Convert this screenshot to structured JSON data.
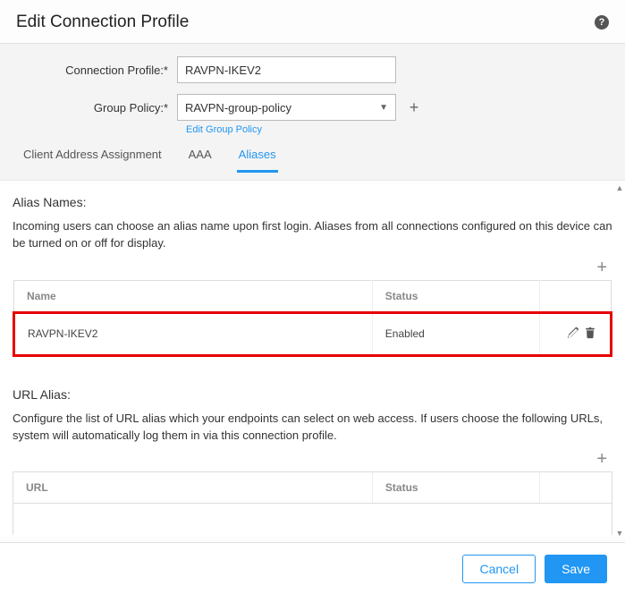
{
  "header": {
    "title": "Edit Connection Profile"
  },
  "form": {
    "connection_profile_label": "Connection Profile:*",
    "connection_profile_value": "RAVPN-IKEV2",
    "group_policy_label": "Group Policy:*",
    "group_policy_value": "RAVPN-group-policy",
    "edit_group_policy_link": "Edit Group Policy"
  },
  "tabs": {
    "client_address": "Client Address Assignment",
    "aaa": "AAA",
    "aliases": "Aliases"
  },
  "alias_names": {
    "title": "Alias Names:",
    "description": "Incoming users can choose an alias name upon first login. Aliases from all connections configured on this device can be turned on or off for display.",
    "col_name": "Name",
    "col_status": "Status",
    "row_name": "RAVPN-IKEV2",
    "row_status": "Enabled"
  },
  "url_alias": {
    "title": "URL Alias:",
    "description": "Configure the list of URL alias which your endpoints can select on web access. If users choose the following URLs, system will automatically log them in via this connection profile.",
    "col_url": "URL",
    "col_status": "Status"
  },
  "footer": {
    "cancel": "Cancel",
    "save": "Save"
  }
}
